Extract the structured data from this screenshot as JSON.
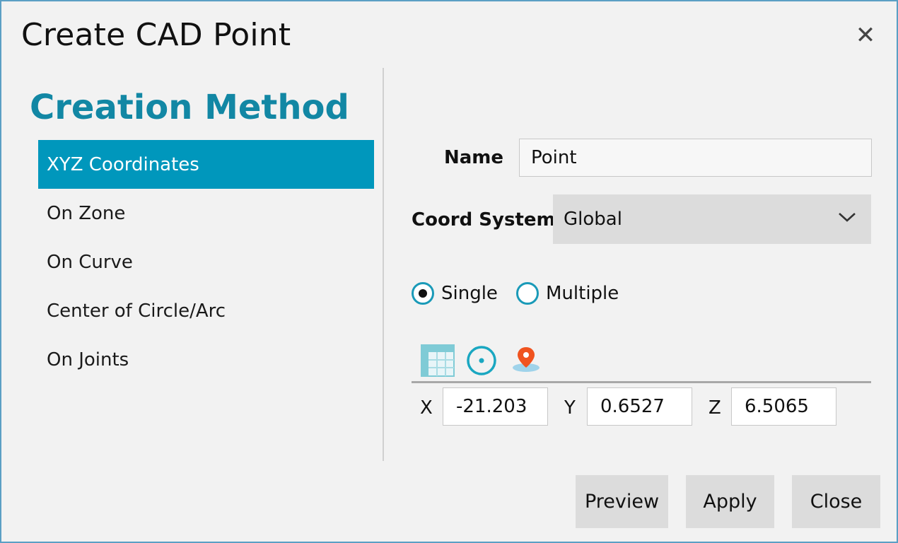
{
  "window": {
    "title": "Create CAD Point"
  },
  "method": {
    "heading": "Creation Method",
    "items": [
      {
        "label": "XYZ Coordinates"
      },
      {
        "label": "On Zone"
      },
      {
        "label": "On Curve"
      },
      {
        "label": "Center of Circle/Arc"
      },
      {
        "label": "On Joints"
      }
    ],
    "selected": "XYZ Coordinates"
  },
  "form": {
    "name_label": "Name",
    "name_value": "Point",
    "coord_label": "Coord System",
    "coord_value": "Global",
    "mode": {
      "single_label": "Single",
      "multiple_label": "Multiple",
      "selected": "Single"
    },
    "toolbar": {
      "icons": [
        "table-icon",
        "circle-center-icon",
        "location-pin-icon"
      ],
      "colors": {
        "table": "#7fcbd6",
        "circle": "#1aa7c1",
        "pin": "#f0531f"
      }
    },
    "coords": {
      "x_label": "X",
      "x_value": "-21.203",
      "y_label": "Y",
      "y_value": "0.6527",
      "z_label": "Z",
      "z_value": "6.5065"
    }
  },
  "buttons": {
    "preview": "Preview",
    "apply": "Apply",
    "close": "Close"
  },
  "colors": {
    "accent": "#0097bc",
    "heading": "#1287a4",
    "background": "#f2f2f2"
  }
}
